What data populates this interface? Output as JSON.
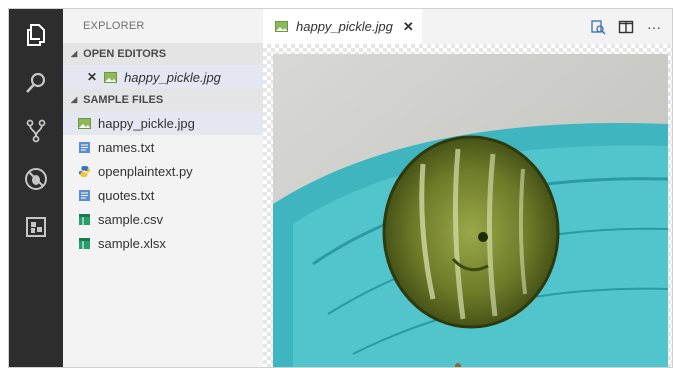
{
  "activity_bar": {
    "icons": [
      "files-icon",
      "search-icon",
      "source-control-icon",
      "debug-icon",
      "extensions-icon"
    ]
  },
  "sidebar": {
    "title": "EXPLORER",
    "open_editors": {
      "header": "OPEN EDITORS",
      "items": [
        {
          "label": "happy_pickle.jpg",
          "icon": "image-file-icon"
        }
      ]
    },
    "sample_files": {
      "header": "SAMPLE FILES",
      "items": [
        {
          "label": "happy_pickle.jpg",
          "icon": "image-file-icon",
          "selected": true
        },
        {
          "label": "names.txt",
          "icon": "text-file-icon"
        },
        {
          "label": "openplaintext.py",
          "icon": "python-file-icon"
        },
        {
          "label": "quotes.txt",
          "icon": "text-file-icon"
        },
        {
          "label": "sample.csv",
          "icon": "spreadsheet-file-icon"
        },
        {
          "label": "sample.xlsx",
          "icon": "spreadsheet-file-icon"
        }
      ]
    }
  },
  "editor": {
    "tab": {
      "label": "happy_pickle.jpg",
      "close_symbol": "✕"
    },
    "actions": [
      "open-preview-icon",
      "split-editor-icon",
      "more-actions-icon"
    ],
    "more_label": "···"
  },
  "colors": {
    "activity_bg": "#2d2d2d",
    "sidebar_bg": "#f3f3f3",
    "selection": "#e4e6f1",
    "plate": "#4bbcc4",
    "pickle": "#6f7a2c"
  }
}
